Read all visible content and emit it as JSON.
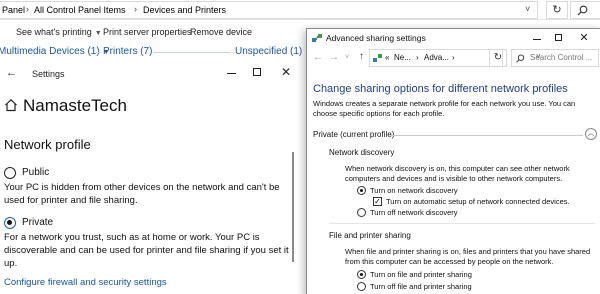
{
  "explorer": {
    "breadcrumb": [
      "Panel",
      "All Control Panel Items",
      "Devices and Printers"
    ],
    "commands": [
      "See what's printing",
      "Print server properties",
      "Remove device"
    ],
    "categories": [
      "Multimedia Devices (1)",
      "Printers (7)",
      "Unspecified (1)"
    ]
  },
  "settings": {
    "window_title": "Settings",
    "page_title": "NamasteTech",
    "section_title": "Network profile",
    "public_label": "Public",
    "public_desc": "Your PC is hidden from other devices on the network and can't be used for printer and file sharing.",
    "private_label": "Private",
    "private_desc": "For a network you trust, such as at home or work. Your PC is discoverable and can be used for printer and file sharing if you set it up.",
    "selected_profile": "Private",
    "firewall_link": "Configure firewall and security settings"
  },
  "advanced": {
    "window_title": "Advanced sharing settings",
    "address": [
      "Ne...",
      "Adva..."
    ],
    "search_placeholder": "Search Control ...",
    "heading": "Change sharing options for different network profiles",
    "intro": "Windows creates a separate network profile for each network you use. You can choose specific options for each profile.",
    "profile_header": "Private (current profile)",
    "network_discovery": {
      "title": "Network discovery",
      "desc": "When network discovery is on, this computer can see other network computers and devices and is visible to other network computers.",
      "turn_on": "Turn on network discovery",
      "auto_setup": "Turn on automatic setup of network connected devices.",
      "turn_off": "Turn off network discovery"
    },
    "file_printer_sharing": {
      "title": "File and printer sharing",
      "desc": "When file and printer sharing is on, files and printers that you have shared from this computer can be accessed by people on the network.",
      "turn_on": "Turn on file and printer sharing",
      "turn_off": "Turn off file and printer sharing"
    }
  }
}
